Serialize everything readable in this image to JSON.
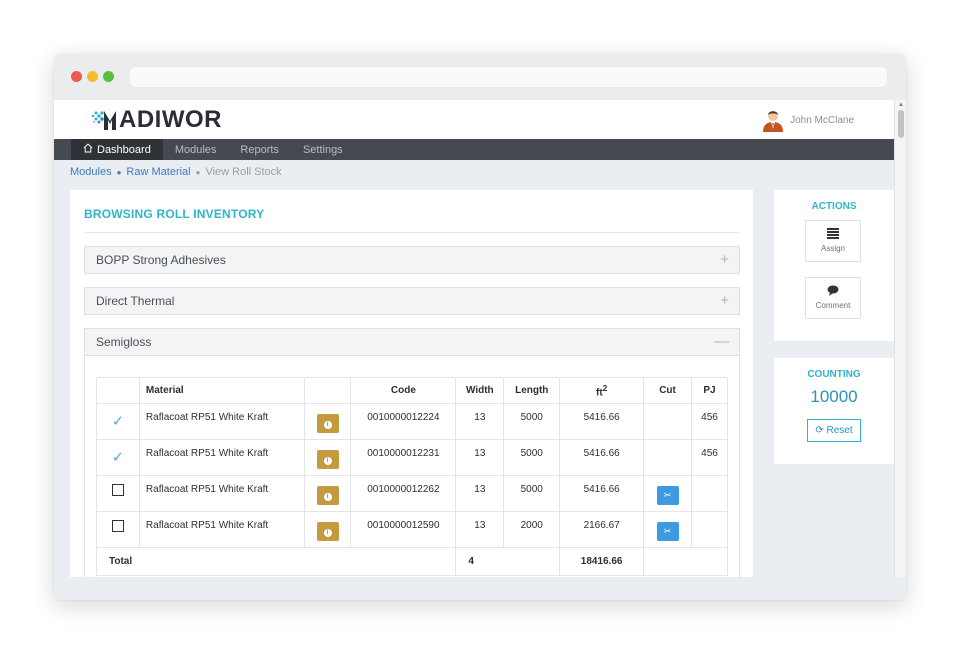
{
  "app": {
    "logo_text": "ADIWOR",
    "logo_initial": "M",
    "user_name": "John McClane"
  },
  "nav": {
    "items": [
      {
        "label": "Dashboard",
        "icon": "home-icon",
        "active": true
      },
      {
        "label": "Modules",
        "active": false
      },
      {
        "label": "Reports",
        "active": false
      },
      {
        "label": "Settings",
        "active": false
      }
    ]
  },
  "breadcrumb": {
    "items": [
      "Modules",
      "Raw Material",
      "View Roll Stock"
    ]
  },
  "panel": {
    "title": "BROWSING ROLL INVENTORY",
    "accordions": [
      {
        "label": "BOPP Strong Adhesives",
        "toggle": "+",
        "expanded": false
      },
      {
        "label": "Direct Thermal",
        "toggle": "+",
        "expanded": false
      },
      {
        "label": "Semigloss",
        "toggle": "—",
        "expanded": true
      }
    ]
  },
  "table": {
    "headers": {
      "material": "Material",
      "code": "Code",
      "width": "Width",
      "length": "Length",
      "ft2": "ft",
      "ft2_sup": "2",
      "cut": "Cut",
      "pj": "PJ"
    },
    "rows": [
      {
        "checked": true,
        "material": "Raflacoat RP51 White Kraft",
        "code": "0010000012224",
        "width": "13",
        "length": "5000",
        "ft2": "5416.66",
        "cut": false,
        "pj": "456"
      },
      {
        "checked": true,
        "material": "Raflacoat RP51 White Kraft",
        "code": "0010000012231",
        "width": "13",
        "length": "5000",
        "ft2": "5416.66",
        "cut": false,
        "pj": "456"
      },
      {
        "checked": false,
        "material": "Raflacoat RP51 White Kraft",
        "code": "0010000012262",
        "width": "13",
        "length": "5000",
        "ft2": "5416.66",
        "cut": true,
        "pj": ""
      },
      {
        "checked": false,
        "material": "Raflacoat RP51 White Kraft",
        "code": "0010000012590",
        "width": "13",
        "length": "2000",
        "ft2": "2166.67",
        "cut": true,
        "pj": ""
      }
    ],
    "total": {
      "label": "Total",
      "width": "4",
      "ft2": "18416.66"
    }
  },
  "actions": {
    "title": "ACTIONS",
    "assign_label": "Assign",
    "assign_icon": "list-icon",
    "comment_label": "Comment",
    "comment_icon": "speech-bubble-icon"
  },
  "counting": {
    "title": "COUNTING",
    "value": "10000",
    "reset_label": "Reset",
    "reset_icon": "refresh-icon"
  },
  "colors": {
    "accent": "#2fb5c9",
    "navbar": "#454a51",
    "info_button": "#c49a3e",
    "cut_button": "#3d9ae0"
  }
}
